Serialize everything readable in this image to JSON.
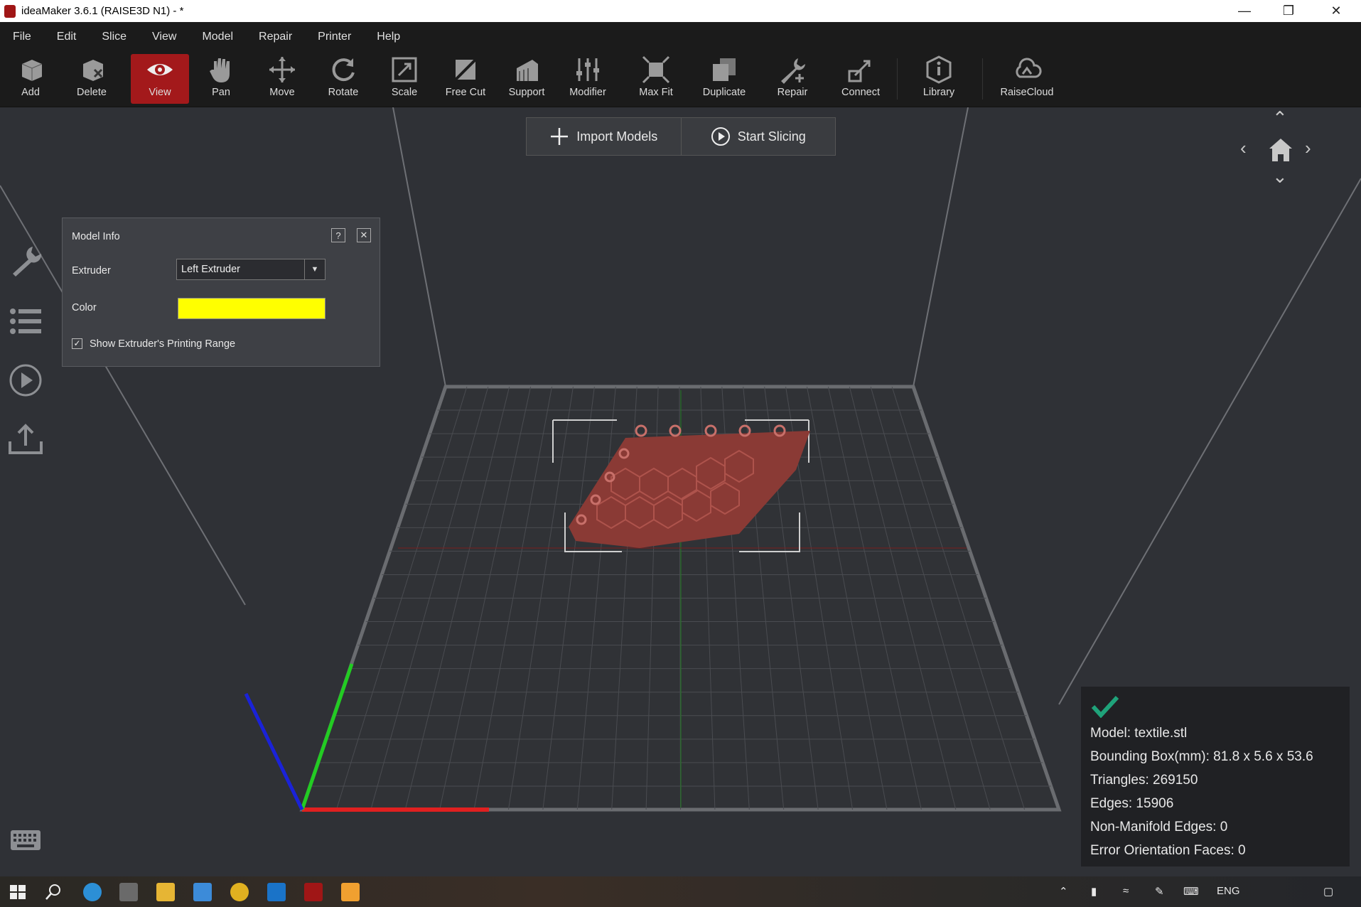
{
  "window": {
    "title": "ideaMaker 3.6.1 (RAISE3D N1) - *"
  },
  "menu": [
    "File",
    "Edit",
    "Slice",
    "View",
    "Model",
    "Repair",
    "Printer",
    "Help"
  ],
  "toolbar": [
    {
      "label": "Add",
      "icon": "add-icon",
      "active": false
    },
    {
      "label": "Delete",
      "icon": "delete-icon",
      "active": false
    },
    {
      "label": "View",
      "icon": "eye-icon",
      "active": true
    },
    {
      "label": "Pan",
      "icon": "hand-icon",
      "active": false
    },
    {
      "label": "Move",
      "icon": "move-arrows-icon",
      "active": false
    },
    {
      "label": "Rotate",
      "icon": "rotate-icon",
      "active": false
    },
    {
      "label": "Scale",
      "icon": "scale-icon",
      "active": false
    },
    {
      "label": "Free Cut",
      "icon": "cut-icon",
      "active": false
    },
    {
      "label": "Support",
      "icon": "support-icon",
      "active": false
    },
    {
      "label": "Modifier",
      "icon": "modifier-icon",
      "active": false
    },
    {
      "label": "Max Fit",
      "icon": "max-fit-icon",
      "active": false
    },
    {
      "label": "Duplicate",
      "icon": "duplicate-icon",
      "active": false
    },
    {
      "label": "Repair",
      "icon": "wrench-icon",
      "active": false
    },
    {
      "label": "Connect",
      "icon": "connect-icon",
      "active": false
    },
    {
      "label": "Library",
      "icon": "library-icon",
      "active": false
    },
    {
      "label": "RaiseCloud",
      "icon": "cloud-icon",
      "active": false
    }
  ],
  "viewport": {
    "import_label": "Import Models",
    "slice_label": "Start Slicing"
  },
  "model_info": {
    "title": "Model Info",
    "help": "?",
    "extruder_label": "Extruder",
    "extruder_value": "Left Extruder",
    "color_label": "Color",
    "color_value": "#ffff00",
    "checkbox_label": "Show Extruder's Printing Range",
    "checkbox_checked": true
  },
  "status": {
    "model": "Model: textile.stl",
    "bbox": "Bounding Box(mm): 81.8 x 5.6 x 53.6",
    "triangles": "Triangles: 269150",
    "edges": "Edges: 15906",
    "non_manifold": "Non-Manifold Edges: 0",
    "error_faces": "Error Orientation Faces: 0"
  },
  "taskbar": {
    "lang": "ENG"
  },
  "colors": {
    "accent": "#a3191b",
    "model": "#8a3a35",
    "status_ok": "#1fa37a"
  }
}
